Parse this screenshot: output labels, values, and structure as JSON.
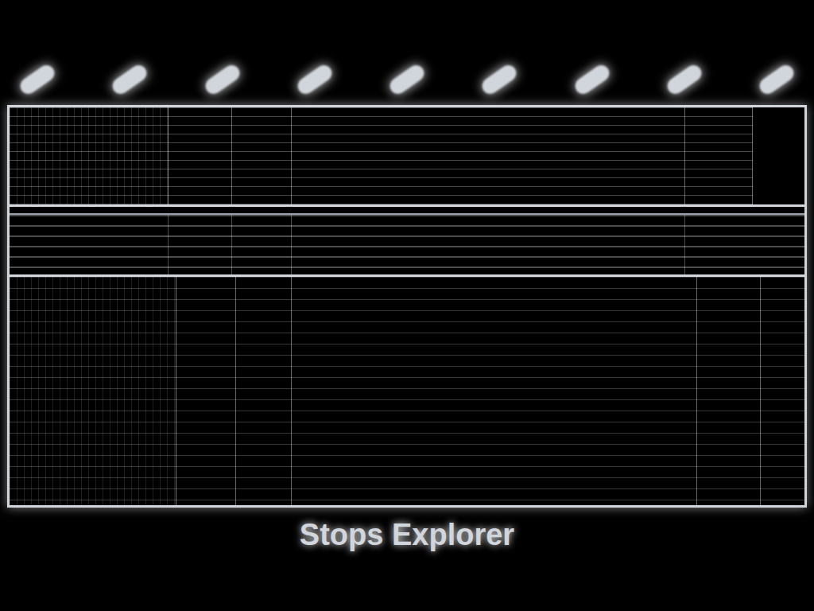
{
  "app": {
    "title": "Stops Explorer"
  }
}
